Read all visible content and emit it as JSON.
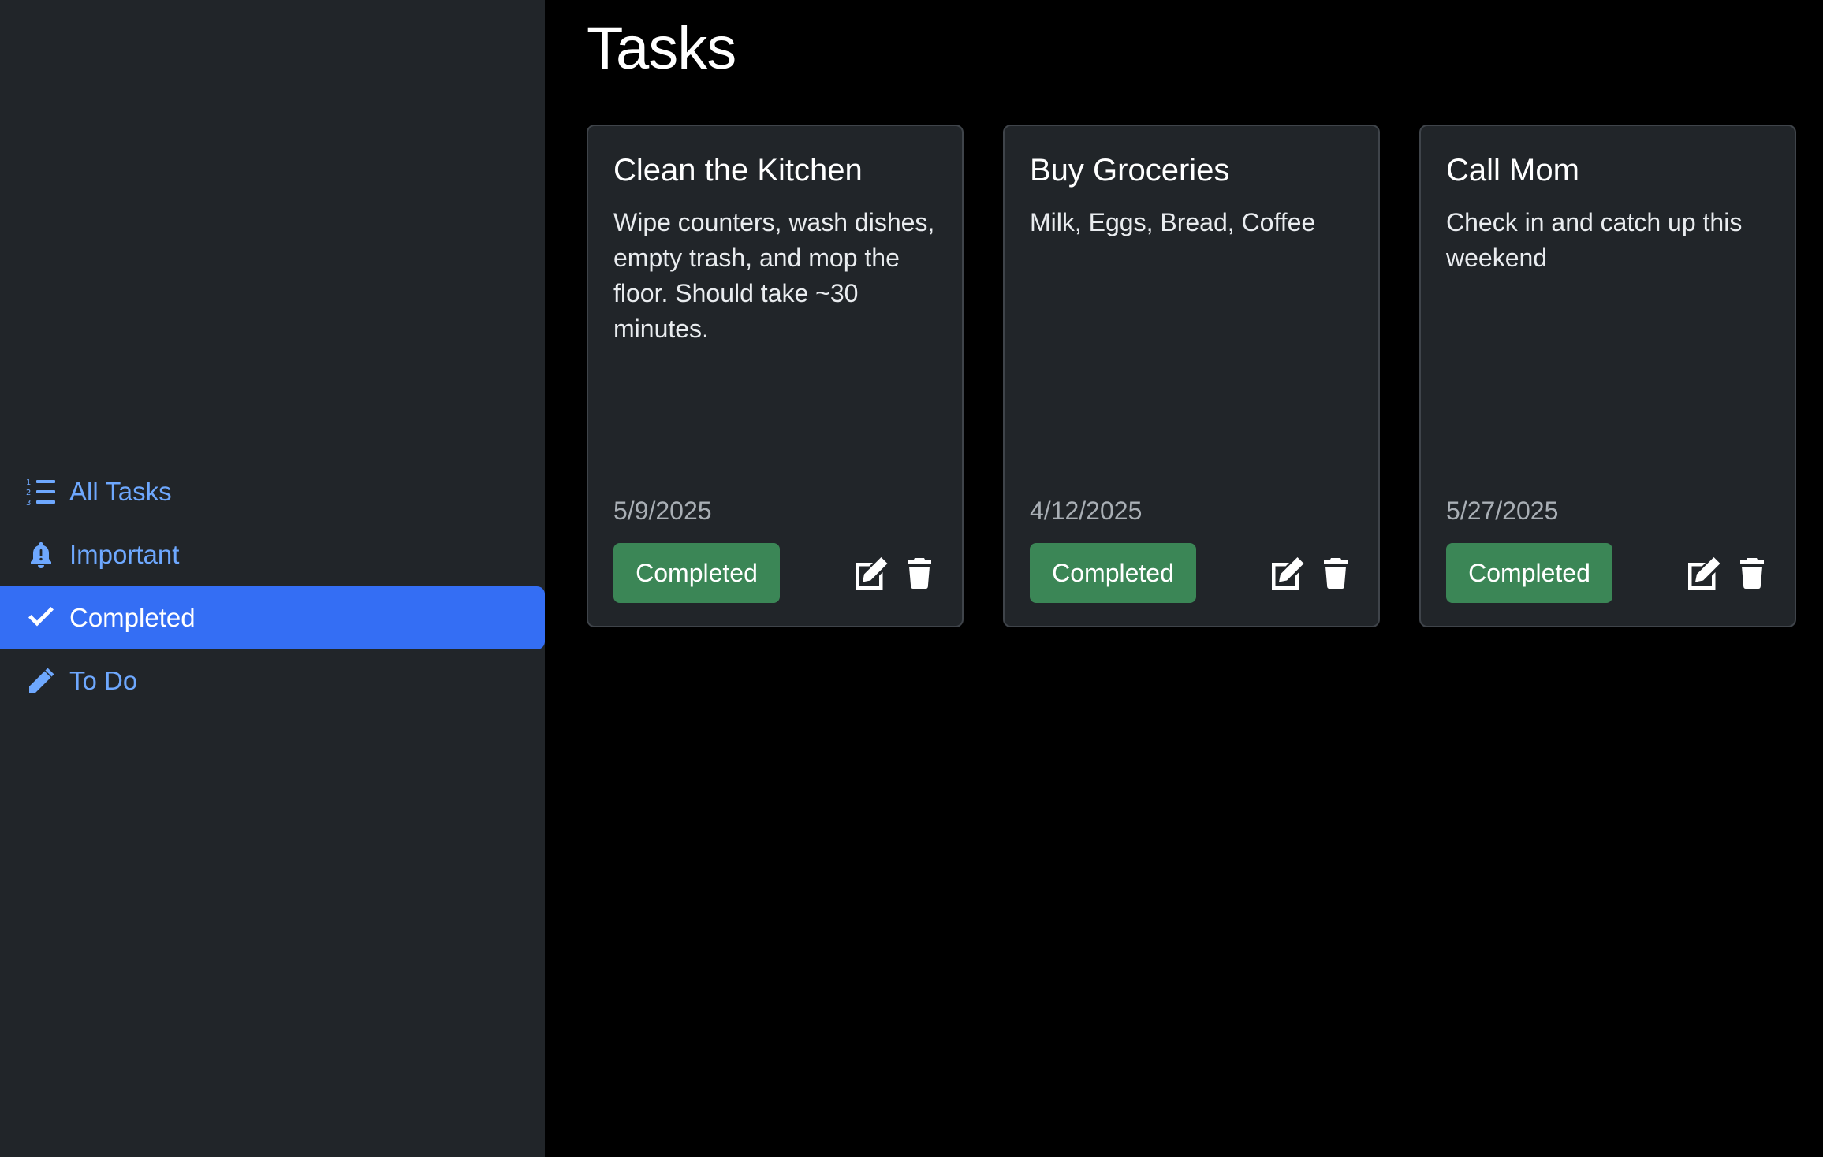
{
  "sidebar": {
    "items": [
      {
        "label": "All Tasks",
        "icon": "list-ol-icon",
        "active": false
      },
      {
        "label": "Important",
        "icon": "bell-exclamation-icon",
        "active": false
      },
      {
        "label": "Completed",
        "icon": "check-icon",
        "active": true
      },
      {
        "label": "To Do",
        "icon": "pencil-icon",
        "active": false
      }
    ]
  },
  "main": {
    "title": "Tasks",
    "cards": [
      {
        "title": "Clean the Kitchen",
        "description": "Wipe counters, wash dishes, empty trash, and mop the floor. Should take ~30 minutes.",
        "date": "5/9/2025",
        "status": "Completed"
      },
      {
        "title": "Buy Groceries",
        "description": "Milk, Eggs, Bread, Coffee",
        "date": "4/12/2025",
        "status": "Completed"
      },
      {
        "title": "Call Mom",
        "description": "Check in and catch up this weekend",
        "date": "5/27/2025",
        "status": "Completed"
      }
    ]
  },
  "colors": {
    "sidebar_bg": "#212529",
    "main_bg": "#000000",
    "accent": "#346ef4",
    "link": "#6ea8fe",
    "status_completed": "#3b8656",
    "card_bg": "#212529"
  }
}
